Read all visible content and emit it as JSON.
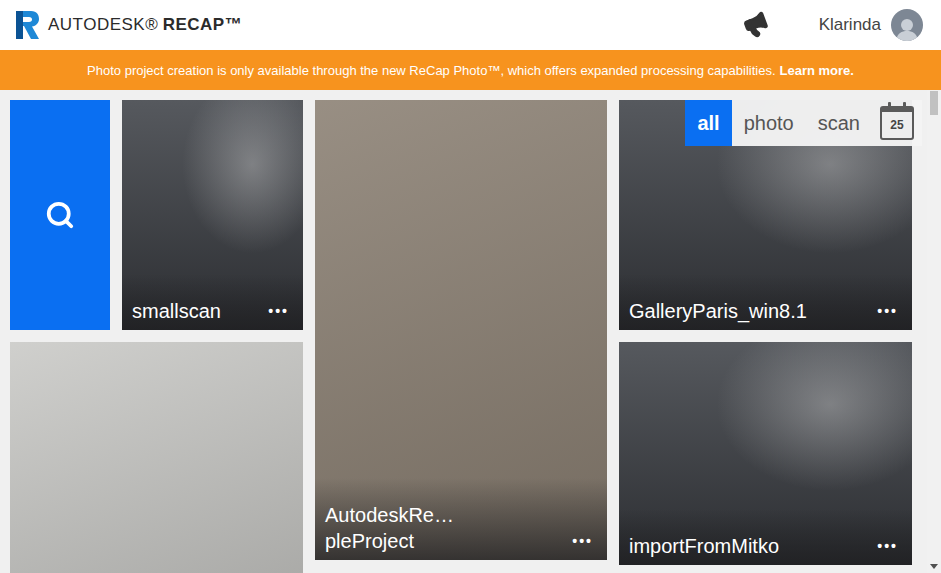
{
  "header": {
    "brand": "AUTODESK®",
    "product": "RECAP™",
    "user": "Klarinda"
  },
  "banner": {
    "text": "Photo project creation is only available through the new ReCap Photo™, which offers expanded processing capabilities.",
    "link": "Learn more."
  },
  "filter": {
    "tabs": [
      {
        "label": "all",
        "selected": true
      },
      {
        "label": "photo",
        "selected": false
      },
      {
        "label": "scan",
        "selected": false
      }
    ],
    "calendar_day": "25"
  },
  "more_label": "•••",
  "projects": [
    {
      "name": [
        "smallscan"
      ],
      "kind": "scan",
      "show_menu": true
    },
    {
      "name": [
        "AutodeskRe…",
        "pleProject"
      ],
      "kind": "photo",
      "color": "#8a7f72",
      "show_menu": true
    },
    {
      "name": [
        "GalleryParis_win8.1"
      ],
      "kind": "scan",
      "show_menu": true
    },
    {
      "name": [],
      "kind": "photo",
      "color": "#c9c9c6",
      "show_menu": false
    },
    {
      "name": [
        "importFromMitko"
      ],
      "kind": "scan",
      "show_menu": true
    }
  ]
}
